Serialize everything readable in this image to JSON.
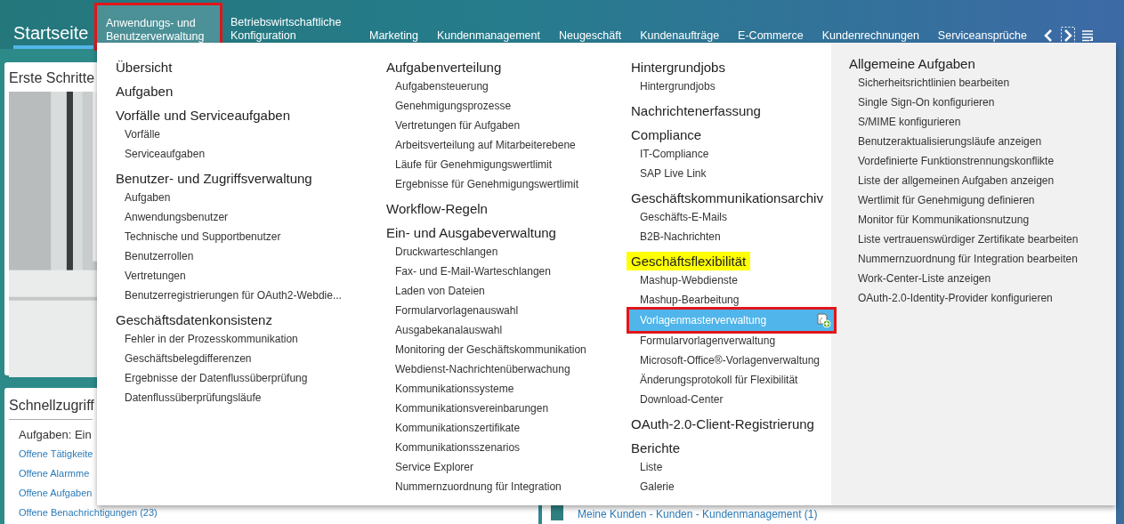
{
  "nav": {
    "tabs": [
      {
        "label": "Startseite",
        "kind": "home",
        "selected": true,
        "open": false
      },
      {
        "label": "Anwendungs- und Benutzerverwaltung",
        "kind": "tab",
        "selected": false,
        "open": true
      },
      {
        "label": "Betriebswirtschaftliche Konfiguration",
        "kind": "tab",
        "selected": false,
        "open": false
      },
      {
        "label": "Marketing",
        "kind": "tab",
        "selected": false,
        "open": false
      },
      {
        "label": "Kundenmanagement",
        "kind": "tab",
        "selected": false,
        "open": false
      },
      {
        "label": "Neugeschäft",
        "kind": "tab",
        "selected": false,
        "open": false
      },
      {
        "label": "Kundenaufträge",
        "kind": "tab",
        "selected": false,
        "open": false
      },
      {
        "label": "E-Commerce",
        "kind": "tab",
        "selected": false,
        "open": false
      },
      {
        "label": "Kundenrechnungen",
        "kind": "tab",
        "selected": false,
        "open": false
      },
      {
        "label": "Serviceansprüche",
        "kind": "tab",
        "selected": false,
        "open": false
      }
    ]
  },
  "background": {
    "cards": [
      {
        "title": "Erste Schritte",
        "kind": "picture"
      },
      {
        "title": "Schnellzugriff",
        "subtitle": "Aufgaben: Ein",
        "links": [
          "Offene Tätigkeite",
          "Offene Alarmme",
          "Offene Aufgaben",
          "Offene Benachrichtigungen (23)"
        ]
      }
    ],
    "right_link": "Meine Kunden - Kunden - Kundenmanagement (1)"
  },
  "menu": {
    "columns": [
      {
        "sections": [
          {
            "heading": "Übersicht",
            "highlighted": false
          },
          {
            "heading": "Aufgaben",
            "highlighted": false
          },
          {
            "heading": "Vorfälle und Serviceaufgaben",
            "highlighted": false,
            "items": [
              {
                "label": "Vorfälle",
                "selected": false
              },
              {
                "label": "Serviceaufgaben",
                "selected": false
              }
            ]
          },
          {
            "heading": "Benutzer- und Zugriffsverwaltung",
            "highlighted": false,
            "items": [
              {
                "label": "Aufgaben",
                "selected": false
              },
              {
                "label": "Anwendungsbenutzer",
                "selected": false
              },
              {
                "label": "Technische und Supportbenutzer",
                "selected": false
              },
              {
                "label": "Benutzerrollen",
                "selected": false
              },
              {
                "label": "Vertretungen",
                "selected": false
              },
              {
                "label": "Benutzerregistrierungen für OAuth2-Webdie...",
                "selected": false
              }
            ]
          },
          {
            "heading": "Geschäftsdatenkonsistenz",
            "highlighted": false,
            "items": [
              {
                "label": "Fehler in der Prozesskommunikation",
                "selected": false
              },
              {
                "label": "Geschäftsbelegdifferenzen",
                "selected": false
              },
              {
                "label": "Ergebnisse der Datenflussüberprüfung",
                "selected": false
              },
              {
                "label": "Datenflussüberprüfungsläufe",
                "selected": false
              }
            ]
          }
        ]
      },
      {
        "sections": [
          {
            "heading": "Aufgabenverteilung",
            "highlighted": false,
            "items": [
              {
                "label": "Aufgabensteuerung",
                "selected": false
              },
              {
                "label": "Genehmigungsprozesse",
                "selected": false
              },
              {
                "label": "Vertretungen für Aufgaben",
                "selected": false
              },
              {
                "label": "Arbeitsverteilung auf Mitarbeiterebene",
                "selected": false
              },
              {
                "label": "Läufe für Genehmigungswertlimit",
                "selected": false
              },
              {
                "label": "Ergebnisse für Genehmigungswertlimit",
                "selected": false
              }
            ]
          },
          {
            "heading": "Workflow-Regeln",
            "highlighted": false
          },
          {
            "heading": "Ein- und Ausgabeverwaltung",
            "highlighted": false,
            "items": [
              {
                "label": "Druckwarteschlangen",
                "selected": false
              },
              {
                "label": "Fax- und E-Mail-Warteschlangen",
                "selected": false
              },
              {
                "label": "Laden von Dateien",
                "selected": false
              },
              {
                "label": "Formularvorlagenauswahl",
                "selected": false
              },
              {
                "label": "Ausgabekanalauswahl",
                "selected": false
              },
              {
                "label": "Monitoring der Geschäftskommunikation",
                "selected": false
              },
              {
                "label": "Webdienst-Nachrichtenüberwachung",
                "selected": false
              },
              {
                "label": "Kommunikationssysteme",
                "selected": false
              },
              {
                "label": "Kommunikationsvereinbarungen",
                "selected": false
              },
              {
                "label": "Kommunikationszertifikate",
                "selected": false
              },
              {
                "label": "Kommunikationsszenarios",
                "selected": false
              },
              {
                "label": "Service Explorer",
                "selected": false
              },
              {
                "label": "Nummernzuordnung für Integration",
                "selected": false
              }
            ]
          }
        ]
      },
      {
        "sections": [
          {
            "heading": "Hintergrundjobs",
            "highlighted": false,
            "items": [
              {
                "label": "Hintergrundjobs",
                "selected": false
              }
            ]
          },
          {
            "heading": "Nachrichtenerfassung",
            "highlighted": false
          },
          {
            "heading": "Compliance",
            "highlighted": false,
            "items": [
              {
                "label": "IT-Compliance",
                "selected": false
              },
              {
                "label": "SAP Live Link",
                "selected": false
              }
            ]
          },
          {
            "heading": "Geschäftskommunikationsarchiv",
            "highlighted": false,
            "items": [
              {
                "label": "Geschäfts-E-Mails",
                "selected": false
              },
              {
                "label": "B2B-Nachrichten",
                "selected": false
              }
            ]
          },
          {
            "heading": "Geschäftsflexibilität",
            "highlighted": true,
            "items": [
              {
                "label": "Mashup-Webdienste",
                "selected": false
              },
              {
                "label": "Mashup-Bearbeitung",
                "selected": false
              },
              {
                "label": "Vorlagenmasterverwaltung",
                "selected": true
              },
              {
                "label": "Formularvorlagenverwaltung",
                "selected": false
              },
              {
                "label": "Microsoft-Office®-Vorlagenverwaltung",
                "selected": false
              },
              {
                "label": "Änderungsprotokoll für Flexibilität",
                "selected": false
              },
              {
                "label": "Download-Center",
                "selected": false
              }
            ]
          },
          {
            "heading": "OAuth-2.0-Client-Registrierung",
            "highlighted": false
          },
          {
            "heading": "Berichte",
            "highlighted": false,
            "items": [
              {
                "label": "Liste",
                "selected": false
              },
              {
                "label": "Galerie",
                "selected": false
              }
            ]
          }
        ]
      },
      {
        "sections": [
          {
            "heading": "Allgemeine Aufgaben",
            "highlighted": false,
            "items": [
              {
                "label": "Sicherheitsrichtlinien bearbeiten",
                "selected": false
              },
              {
                "label": "Single Sign-On konfigurieren",
                "selected": false
              },
              {
                "label": "S/MIME konfigurieren",
                "selected": false
              },
              {
                "label": "Benutzeraktualisierungsläufe anzeigen",
                "selected": false
              },
              {
                "label": "Vordefinierte Funktionstrennungskonflikte",
                "selected": false
              },
              {
                "label": "Liste der allgemeinen Aufgaben anzeigen",
                "selected": false
              },
              {
                "label": "Wertlimit für Genehmigung definieren",
                "selected": false
              },
              {
                "label": "Monitor für Kommunikationsnutzung",
                "selected": false
              },
              {
                "label": "Liste vertrauenswürdiger Zertifikate bearbeiten",
                "selected": false
              },
              {
                "label": "Nummernzuordnung für Integration bearbeiten",
                "selected": false
              },
              {
                "label": "Work-Center-Liste anzeigen",
                "selected": false
              },
              {
                "label": "OAuth-2.0-Identity-Provider konfigurieren",
                "selected": false
              }
            ]
          }
        ]
      }
    ]
  }
}
